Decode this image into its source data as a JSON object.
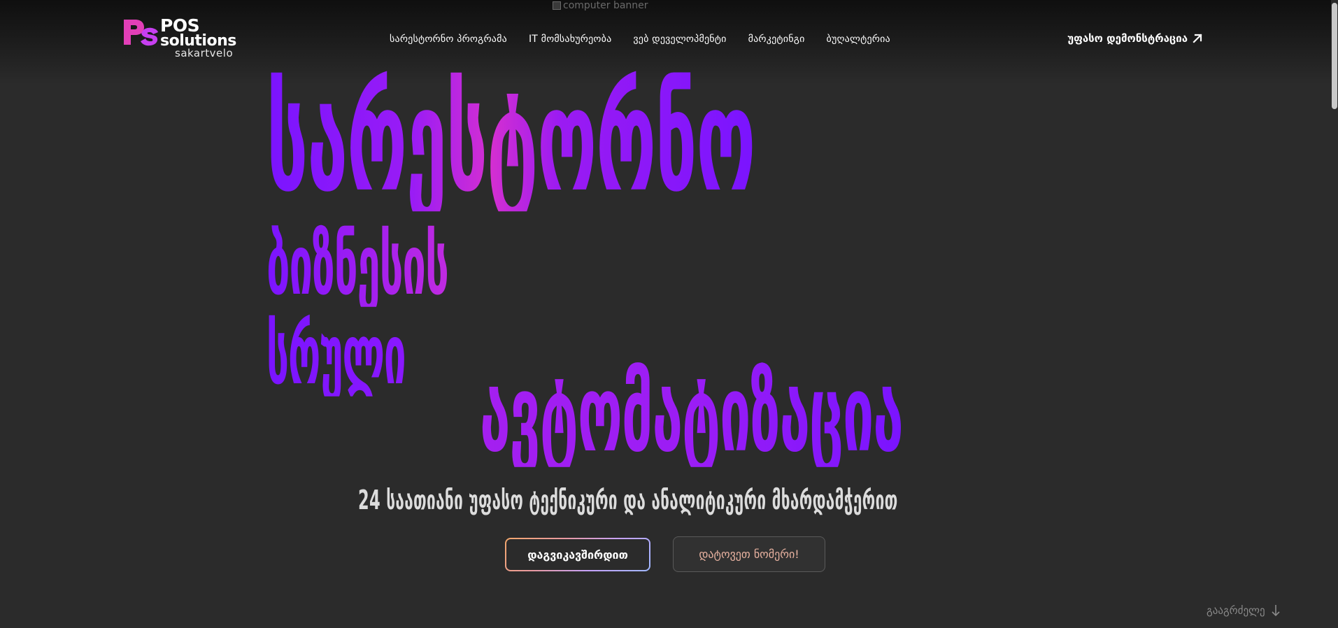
{
  "page": {
    "broken_banner_alt": "computer banner"
  },
  "logo": {
    "line1": "POS",
    "line2": "solutions",
    "line3": "sakartvelo",
    "colors": {
      "mark_primary": "#e23fb7",
      "mark_secondary": "#a53bff"
    }
  },
  "nav": {
    "items": [
      {
        "label": "სარესტორნო პროგრამა"
      },
      {
        "label": "IT მომსახურეობა"
      },
      {
        "label": "ვებ დეველოპმენტი"
      },
      {
        "label": "მარკეტინგი"
      },
      {
        "label": "ბუღალტერია"
      }
    ],
    "cta_label": "უფასო დემონსტრაცია",
    "cta_icon": "arrow-ne-icon"
  },
  "hero": {
    "line1": "სარესტორნო",
    "line2": "ბიზნესის",
    "line3": "სრული",
    "line4": "ავტომატიზაცია",
    "gradient_colors": [
      "#7a14ff",
      "#d42fd1"
    ]
  },
  "subheading": "24 საათიანი უფასო ტექნიკური და ანალიტიკური მხარდამჭერით",
  "buttons": {
    "contact_label": "დაგვიკავშირდით",
    "leave_number_label": "დატოვეთ ნომერი!"
  },
  "continue": {
    "label": "გააგრძელე",
    "icon": "arrow-down-icon"
  },
  "colors": {
    "background": "#2b2b2b",
    "accent_purple": "#7a14ff",
    "accent_pink": "#d42fd1"
  }
}
